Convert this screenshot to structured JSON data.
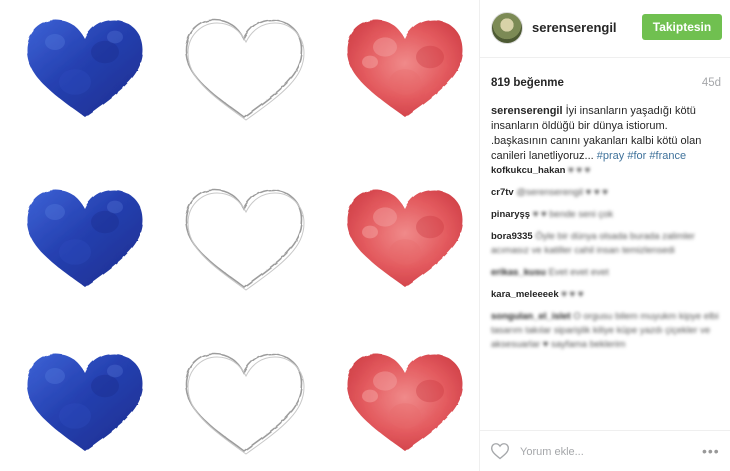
{
  "post": {
    "image_alt": "hearts",
    "image_colors": {
      "blue": "#2a45b8",
      "outline": "#9a9a9a",
      "red": "#e0565a"
    }
  },
  "header": {
    "avatar_icon": "avatar",
    "username": "serenserengil",
    "follow_label": "Takiptesin",
    "follow_color": "#70c050"
  },
  "stats": {
    "likes": "819 beğenme",
    "age": "45d"
  },
  "caption": {
    "username": "serenserengil",
    "text": "İyi insanların yaşadığı kötü insanların öldüğü bir dünya istiorum. .başkasının canını yakanları kalbi kötü olan canileri lanetliyoruz... ",
    "hashtags": [
      "#pray",
      "#for",
      "#france"
    ]
  },
  "comments": [
    {
      "user": "kofkukcu_hakan",
      "text": "♥ ♥ ♥"
    },
    {
      "user": "cr7tv",
      "text": "@serenserengil ♥ ♥ ♥"
    },
    {
      "user": "pinaryşş",
      "text": "♥ ♥ bende seni çok"
    },
    {
      "user": "bora9335",
      "text": "Öyle bir dünya olsada burada zalimler acımasız ve katiller cahil insan temizlensedi"
    },
    {
      "user": "erikas_kusu",
      "text": "Evet evet evet"
    },
    {
      "user": "kara_meleeeek",
      "text": "♥ ♥ ♥"
    },
    {
      "user": "songulan_el_islet",
      "text": "O orgusu bilem muyukm kipye elbi tasarım takılar siparişlik kiliye küpe yazdı çiçekler ve aksesuarlar ♥ sayfama beklerim"
    }
  ],
  "footer": {
    "like_icon": "heart-outline-icon",
    "comment_placeholder": "Yorum ekle...",
    "more_label": "•••"
  }
}
